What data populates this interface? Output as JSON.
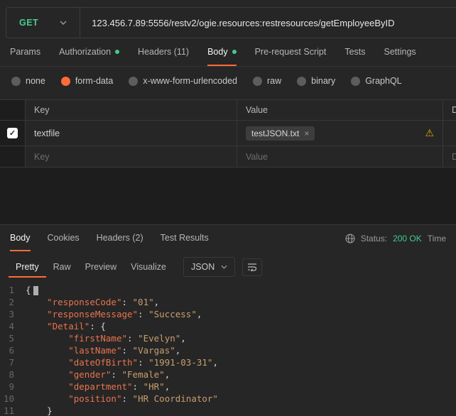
{
  "colors": {
    "accent_orange": "#ff6c37",
    "method_green": "#49cc90",
    "status_green": "#45c98c",
    "warning_amber": "#d9a40b",
    "json_key": "#e8734d",
    "json_string": "#c99e6e"
  },
  "request": {
    "method": "GET",
    "url": "123.456.7.89:5556/restv2/ogie.resources:restresources/getEmployeeByID",
    "tabs": [
      {
        "label": "Params"
      },
      {
        "label": "Authorization",
        "dot": true
      },
      {
        "label": "Headers (11)"
      },
      {
        "label": "Body",
        "dot": true,
        "active": true
      },
      {
        "label": "Pre-request Script"
      },
      {
        "label": "Tests"
      },
      {
        "label": "Settings"
      }
    ],
    "body_types": [
      {
        "label": "none"
      },
      {
        "label": "form-data",
        "selected": true
      },
      {
        "label": "x-www-form-urlencoded"
      },
      {
        "label": "raw"
      },
      {
        "label": "binary"
      },
      {
        "label": "GraphQL"
      }
    ],
    "form_table": {
      "headers": [
        "Key",
        "Value",
        "De"
      ],
      "rows": [
        {
          "checked": true,
          "key": "textfile",
          "value_chip": "testJSON.txt",
          "warning": true
        }
      ],
      "placeholder_row": {
        "key": "Key",
        "value": "Value",
        "description": "De"
      }
    }
  },
  "response": {
    "tabs": [
      {
        "label": "Body",
        "active": true
      },
      {
        "label": "Cookies"
      },
      {
        "label": "Headers (2)"
      },
      {
        "label": "Test Results"
      }
    ],
    "status_label": "Status:",
    "status_value": "200 OK",
    "time_label": "Time",
    "views": [
      {
        "label": "Pretty",
        "active": true
      },
      {
        "label": "Raw"
      },
      {
        "label": "Preview"
      },
      {
        "label": "Visualize"
      }
    ],
    "format": "JSON",
    "code": {
      "lines": [
        {
          "num": 1,
          "indent": 0,
          "tokens": [
            {
              "type": "pun",
              "text": "{"
            },
            {
              "type": "cursor",
              "text": ""
            }
          ]
        },
        {
          "num": 2,
          "indent": 1,
          "tokens": [
            {
              "type": "key",
              "text": "\"responseCode\""
            },
            {
              "type": "pun",
              "text": ": "
            },
            {
              "type": "str",
              "text": "\"01\""
            },
            {
              "type": "pun",
              "text": ","
            }
          ]
        },
        {
          "num": 3,
          "indent": 1,
          "tokens": [
            {
              "type": "key",
              "text": "\"responseMessage\""
            },
            {
              "type": "pun",
              "text": ": "
            },
            {
              "type": "str",
              "text": "\"Success\""
            },
            {
              "type": "pun",
              "text": ","
            }
          ]
        },
        {
          "num": 4,
          "indent": 1,
          "tokens": [
            {
              "type": "key",
              "text": "\"Detail\""
            },
            {
              "type": "pun",
              "text": ": {"
            }
          ]
        },
        {
          "num": 5,
          "indent": 2,
          "tokens": [
            {
              "type": "key",
              "text": "\"firstName\""
            },
            {
              "type": "pun",
              "text": ": "
            },
            {
              "type": "str",
              "text": "\"Evelyn\""
            },
            {
              "type": "pun",
              "text": ","
            }
          ]
        },
        {
          "num": 6,
          "indent": 2,
          "tokens": [
            {
              "type": "key",
              "text": "\"lastName\""
            },
            {
              "type": "pun",
              "text": ": "
            },
            {
              "type": "str",
              "text": "\"Vargas\""
            },
            {
              "type": "pun",
              "text": ","
            }
          ]
        },
        {
          "num": 7,
          "indent": 2,
          "tokens": [
            {
              "type": "key",
              "text": "\"dateOfBirth\""
            },
            {
              "type": "pun",
              "text": ": "
            },
            {
              "type": "str",
              "text": "\"1991-03-31\""
            },
            {
              "type": "pun",
              "text": ","
            }
          ]
        },
        {
          "num": 8,
          "indent": 2,
          "tokens": [
            {
              "type": "key",
              "text": "\"gender\""
            },
            {
              "type": "pun",
              "text": ": "
            },
            {
              "type": "str",
              "text": "\"Female\""
            },
            {
              "type": "pun",
              "text": ","
            }
          ]
        },
        {
          "num": 9,
          "indent": 2,
          "tokens": [
            {
              "type": "key",
              "text": "\"department\""
            },
            {
              "type": "pun",
              "text": ": "
            },
            {
              "type": "str",
              "text": "\"HR\""
            },
            {
              "type": "pun",
              "text": ","
            }
          ]
        },
        {
          "num": 10,
          "indent": 2,
          "tokens": [
            {
              "type": "key",
              "text": "\"position\""
            },
            {
              "type": "pun",
              "text": ": "
            },
            {
              "type": "str",
              "text": "\"HR Coordinator\""
            }
          ]
        },
        {
          "num": 11,
          "indent": 1,
          "tokens": [
            {
              "type": "pun",
              "text": "}"
            }
          ]
        }
      ]
    }
  }
}
